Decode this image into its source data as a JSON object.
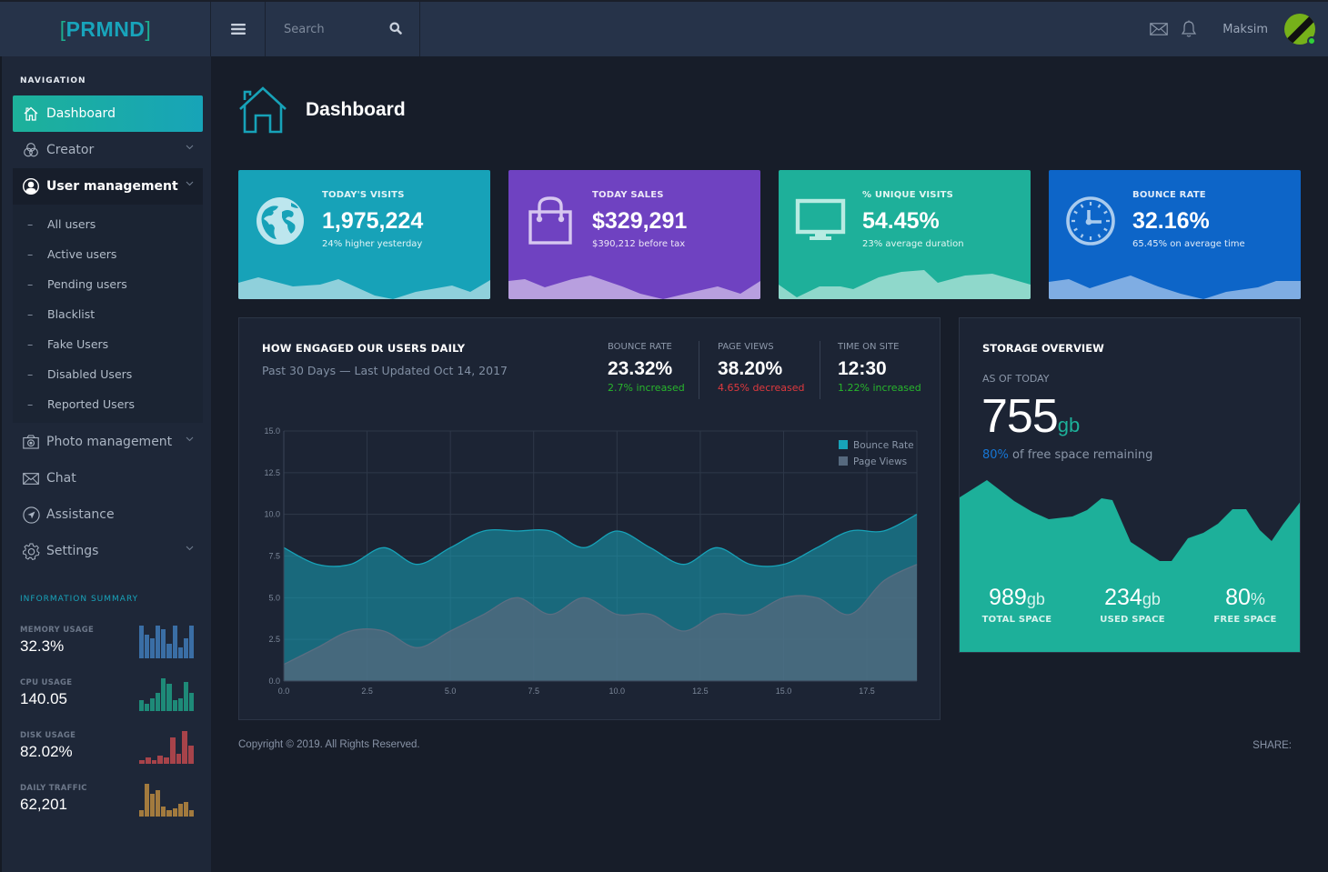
{
  "brand": {
    "open": "[",
    "name": "PRMND",
    "close": "]"
  },
  "topbar": {
    "search_placeholder": "Search",
    "username": "Maksim"
  },
  "sidebar": {
    "nav_heading": "NAVIGATION",
    "items": [
      {
        "label": "Dashboard",
        "icon": "home-icon",
        "active": true
      },
      {
        "label": "Creator",
        "icon": "circles-icon",
        "has_children": true
      },
      {
        "label": "User management",
        "icon": "user-icon",
        "has_children": true,
        "open": true
      },
      {
        "label": "Photo management",
        "icon": "camera-icon",
        "has_children": true
      },
      {
        "label": "Chat",
        "icon": "envelope-icon"
      },
      {
        "label": "Assistance",
        "icon": "navigation-icon"
      },
      {
        "label": "Settings",
        "icon": "gear-icon",
        "has_children": true
      }
    ],
    "submenu": [
      "All users",
      "Active users",
      "Pending users",
      "Blacklist",
      "Fake Users",
      "Disabled Users",
      "Reported Users"
    ],
    "sub_bullet": "–",
    "info_heading": "INFORMATION SUMMARY",
    "metrics": [
      {
        "label": "MEMORY USAGE",
        "value": "32.3%",
        "color": "#3a6ea5",
        "bars": [
          9,
          6.5,
          5.5,
          9,
          8,
          4,
          9,
          3,
          5.5,
          9
        ]
      },
      {
        "label": "CPU USAGE",
        "value": "140.05",
        "color": "#1e8a78",
        "bars": [
          3,
          2,
          3.5,
          5,
          9,
          7.5,
          3,
          3.5,
          8,
          5
        ]
      },
      {
        "label": "DISK USAGE",
        "value": "82.02%",
        "color": "#a7434a",
        "bars": [
          1,
          2,
          1,
          2.5,
          2,
          8,
          3,
          10,
          5.5
        ]
      },
      {
        "label": "DAILY TRAFFIC",
        "value": "62,201",
        "color": "#a27a3e",
        "bars": [
          2,
          10,
          7,
          8,
          3,
          2,
          2.5,
          4,
          4.5,
          2
        ]
      }
    ]
  },
  "page": {
    "title": "Dashboard"
  },
  "stats": [
    {
      "title": "TODAY'S VISITS",
      "value": "1,975,224",
      "sub": "24% higher yesterday",
      "icon": "globe-icon",
      "color": "#17a2b8",
      "wave": "#8fd0db"
    },
    {
      "title": "TODAY SALES",
      "value": "$329,291",
      "sub": "$390,212 before tax",
      "icon": "shopping-bag-icon",
      "color": "#6f42c1",
      "wave": "#b89fdf"
    },
    {
      "title": "% UNIQUE VISITS",
      "value": "54.45%",
      "sub": "23% average duration",
      "icon": "monitor-icon",
      "color": "#1eb09a",
      "wave": "#8fd8cb"
    },
    {
      "title": "BOUNCE RATE",
      "value": "32.16%",
      "sub": "65.45% on average time",
      "icon": "clock-icon",
      "color": "#0d65c8",
      "wave": "#7fade3"
    }
  ],
  "engagement": {
    "title": "HOW ENGAGED OUR USERS DAILY",
    "subtitle": "Past 30 Days — Last Updated Oct 14, 2017",
    "kpis": [
      {
        "label": "BOUNCE RATE",
        "value": "23.32%",
        "change": "2.7% increased",
        "trend": "up",
        "color": "#28b62c"
      },
      {
        "label": "PAGE VIEWS",
        "value": "38.20%",
        "change": "4.65% decreased",
        "trend": "down",
        "color": "#e0393e"
      },
      {
        "label": "TIME ON SITE",
        "value": "12:30",
        "change": "1.22% increased",
        "trend": "up",
        "color": "#28b62c"
      }
    ]
  },
  "chart_data": {
    "type": "area",
    "title": "HOW ENGAGED OUR USERS DAILY",
    "xlabel": "",
    "ylabel": "",
    "x": [
      0,
      1,
      2,
      3,
      4,
      5,
      6,
      7,
      8,
      9,
      10,
      11,
      12,
      13,
      14,
      15,
      16,
      17,
      18,
      19
    ],
    "xlim": [
      0,
      19
    ],
    "ylim": [
      0,
      15
    ],
    "xticks": [
      "0.0",
      "2.5",
      "5.0",
      "7.5",
      "10.0",
      "12.5",
      "15.0",
      "17.5"
    ],
    "yticks": [
      "0.0",
      "2.5",
      "5.0",
      "7.5",
      "10.0",
      "12.5",
      "15.0"
    ],
    "grid": true,
    "legend": "top-right",
    "series": [
      {
        "name": "Bounce Rate",
        "color": "#17a2b8",
        "values": [
          8,
          7,
          7,
          8,
          7,
          8,
          9,
          9,
          9,
          8,
          9,
          8,
          7,
          8,
          7,
          7,
          8,
          9,
          9,
          10
        ]
      },
      {
        "name": "Page Views",
        "color": "#56697e",
        "values": [
          1,
          2,
          3,
          3,
          2,
          3,
          4,
          5,
          4,
          5,
          4,
          4,
          3,
          4,
          4,
          5,
          5,
          4,
          6,
          7
        ]
      }
    ]
  },
  "storage": {
    "title": "STORAGE OVERVIEW",
    "as_of": "AS OF TODAY",
    "amount": "755",
    "unit": "gb",
    "free_pct": "80%",
    "free_text": "of free space remaining",
    "wave_color": "#1db09a",
    "columns": [
      {
        "value": "989",
        "unit": "gb",
        "label": "TOTAL SPACE"
      },
      {
        "value": "234",
        "unit": "gb",
        "label": "USED SPACE"
      },
      {
        "value": "80",
        "unit": "%",
        "label": "FREE SPACE"
      }
    ]
  },
  "footer": {
    "copyright": "Copyright © 2019. All Rights Reserved.",
    "share": "SHARE:"
  }
}
